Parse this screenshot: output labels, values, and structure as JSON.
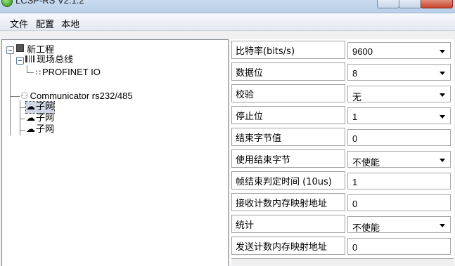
{
  "window": {
    "title": "LCSP-RS V2.1.2"
  },
  "menu": [
    "文件",
    "配置",
    "本地"
  ],
  "tree": {
    "root": "新工程",
    "fieldbus": "现场总线",
    "profinet": "PROFINET IO",
    "communicator": "Communicator rs232/485",
    "subnets": [
      "子网",
      "子网",
      "子网"
    ]
  },
  "properties": [
    {
      "label": "比特率(bits/s)",
      "value": "9600",
      "type": "select"
    },
    {
      "label": "数据位",
      "value": "8",
      "type": "select"
    },
    {
      "label": "校验",
      "value": "无",
      "type": "select"
    },
    {
      "label": "停止位",
      "value": "1",
      "type": "select"
    },
    {
      "label": "结束字节值",
      "value": "0",
      "type": "text"
    },
    {
      "label": "使用结束字节",
      "value": "不使能",
      "type": "select"
    },
    {
      "label": "帧结束判定时间 (10us)",
      "value": "1",
      "type": "text"
    },
    {
      "label": "接收计数内存映射地址",
      "value": "0",
      "type": "text"
    },
    {
      "label": "统计",
      "value": "不使能",
      "type": "select"
    },
    {
      "label": "发送计数内存映射地址",
      "value": "0",
      "type": "text"
    }
  ]
}
